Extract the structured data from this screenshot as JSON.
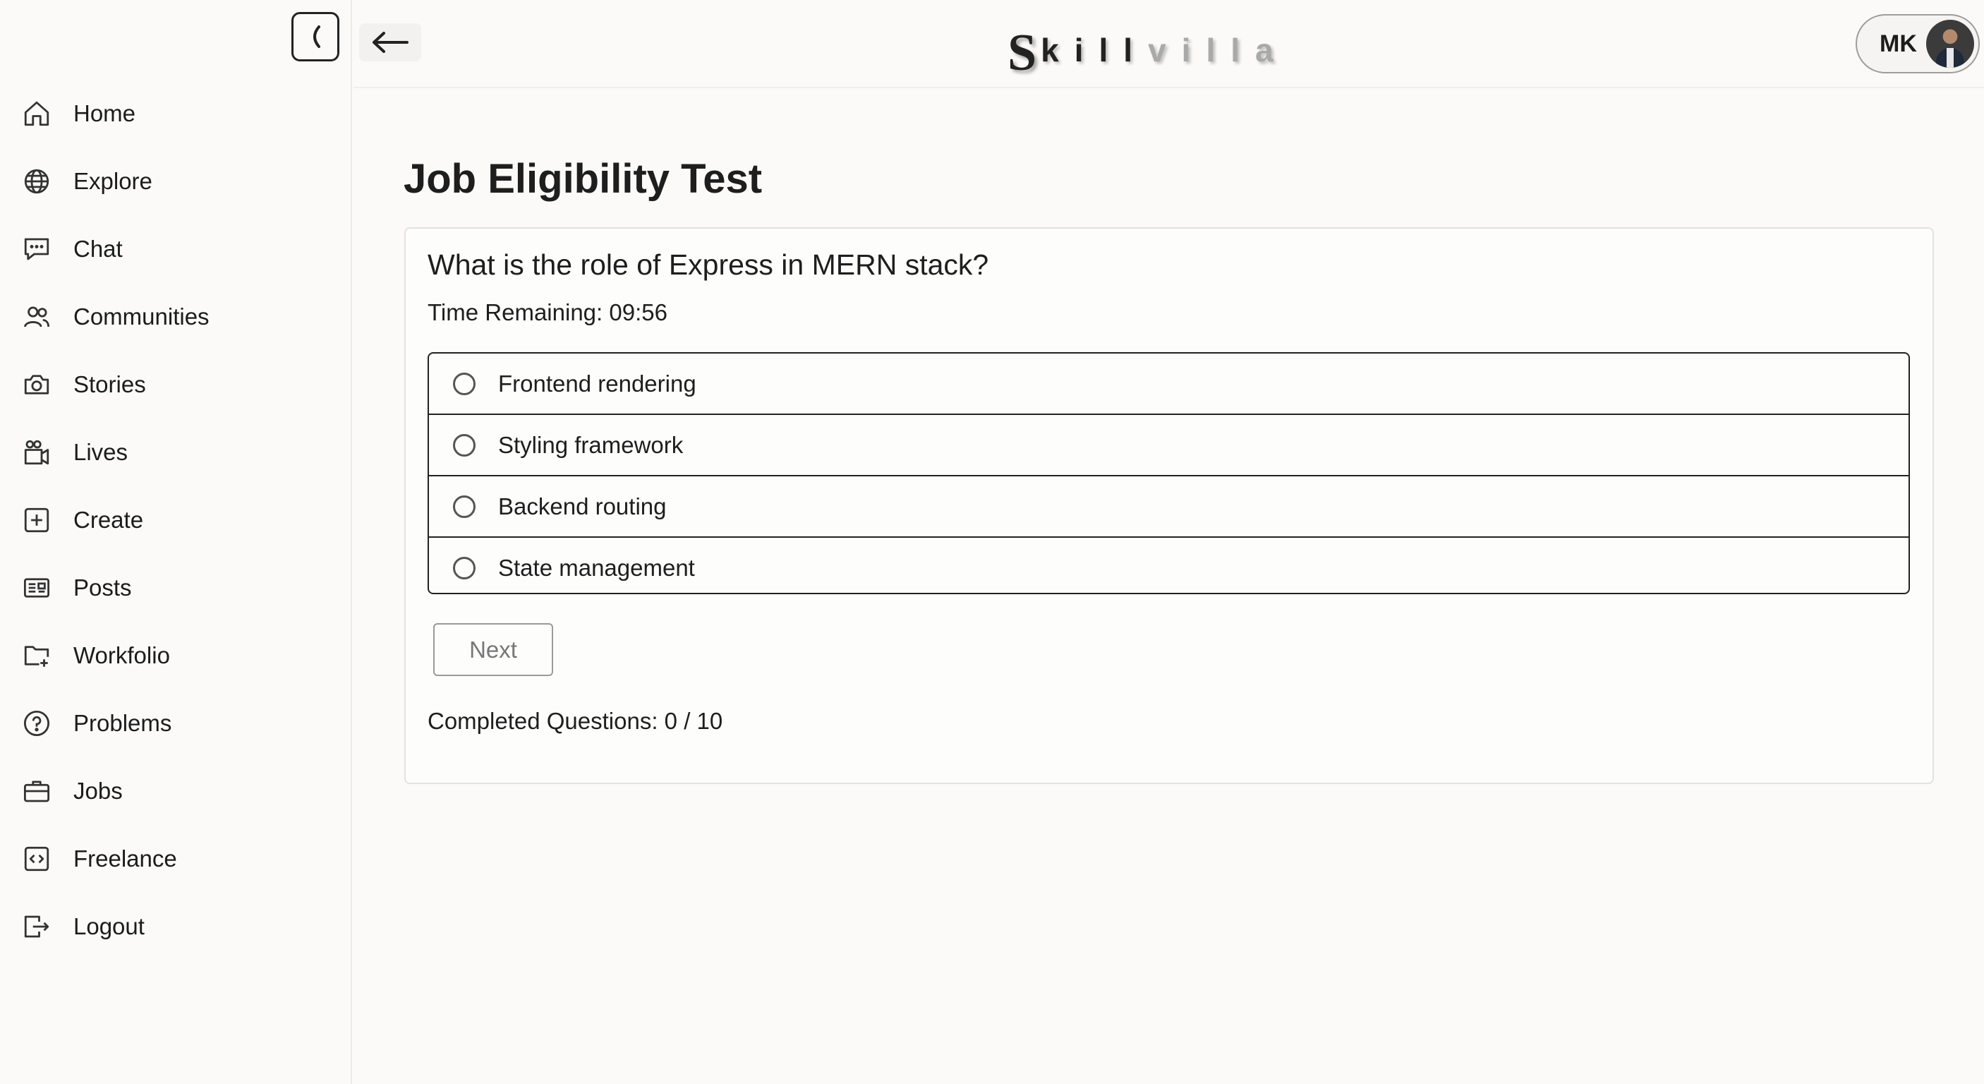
{
  "sidebar": {
    "collapse_icon": "chevron-left-icon",
    "items": [
      {
        "label": "Home",
        "icon": "home-icon"
      },
      {
        "label": "Explore",
        "icon": "globe-icon"
      },
      {
        "label": "Chat",
        "icon": "chat-icon"
      },
      {
        "label": "Communities",
        "icon": "users-icon"
      },
      {
        "label": "Stories",
        "icon": "camera-icon"
      },
      {
        "label": "Lives",
        "icon": "video-icon"
      },
      {
        "label": "Create",
        "icon": "plus-square-icon"
      },
      {
        "label": "Posts",
        "icon": "newspaper-icon"
      },
      {
        "label": "Workfolio",
        "icon": "folder-plus-icon"
      },
      {
        "label": "Problems",
        "icon": "help-circle-icon"
      },
      {
        "label": "Jobs",
        "icon": "briefcase-icon"
      },
      {
        "label": "Freelance",
        "icon": "code-square-icon"
      },
      {
        "label": "Logout",
        "icon": "logout-icon"
      }
    ]
  },
  "header": {
    "back_icon": "arrow-left-icon",
    "logo": {
      "first": "S",
      "skill": "kill",
      "villa": "villa"
    },
    "profile_initials": "MK"
  },
  "main": {
    "title": "Job Eligibility Test",
    "question": "What is the role of Express in MERN stack?",
    "timer": "Time Remaining: 09:56",
    "options": [
      "Frontend rendering",
      "Styling framework",
      "Backend routing",
      "State management"
    ],
    "next_label": "Next",
    "completed": "Completed Questions: 0 / 10"
  }
}
